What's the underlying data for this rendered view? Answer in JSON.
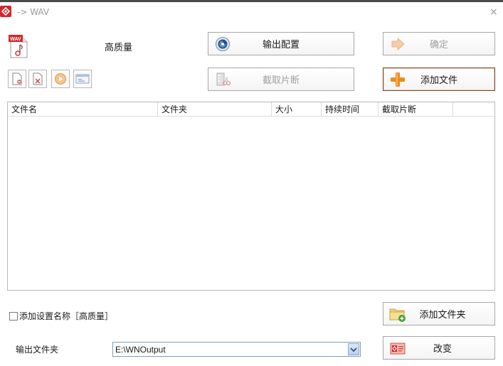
{
  "window": {
    "title": "-> WAV",
    "close_glyph": "×"
  },
  "format": {
    "icon_text": "WAV",
    "quality_label": "高质量"
  },
  "buttons": {
    "output_config": "输出配置",
    "confirm": "确定",
    "trim": "截取片断",
    "add_file": "添加文件",
    "add_folder": "添加文件夹",
    "change": "改变"
  },
  "file_list": {
    "columns": [
      "文件名",
      "文件夹",
      "大小",
      "持续时间",
      "截取片断"
    ],
    "rows": []
  },
  "options": {
    "add_setting_name_label": "添加设置名称［高质量］",
    "add_setting_name_checked": false
  },
  "output": {
    "folder_label": "输出文件夹",
    "folder_value": "E:\\WNOutput"
  },
  "colors": {
    "accent": "#d6262c",
    "add_orange": "#f08a1c",
    "disabled_text": "#a0a0a0"
  }
}
